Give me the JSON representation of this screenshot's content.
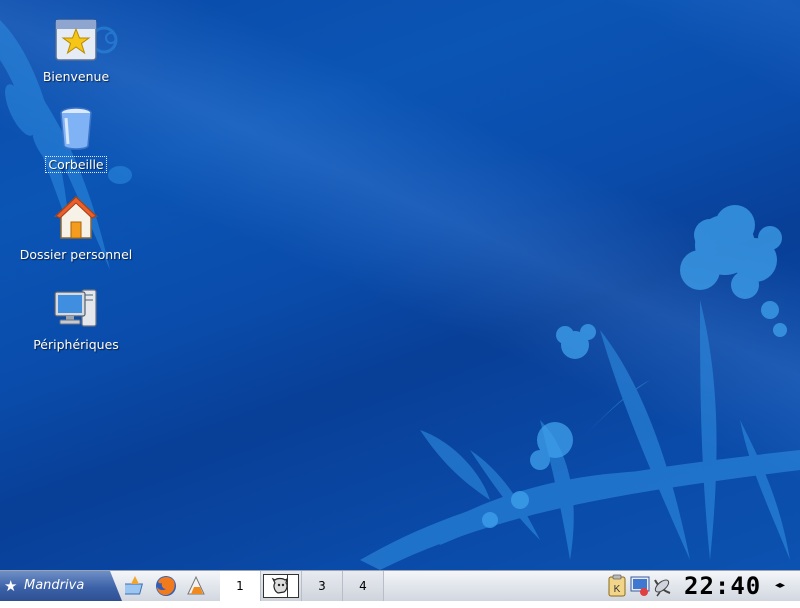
{
  "desktop": {
    "icons": [
      {
        "label": "Bienvenue",
        "icon": "welcome-star-icon"
      },
      {
        "label": "Corbeille",
        "icon": "trash-icon"
      },
      {
        "label": "Dossier personnel",
        "icon": "home-folder-icon"
      },
      {
        "label": "Périphériques",
        "icon": "computer-icon"
      }
    ]
  },
  "taskbar": {
    "start_label": "Mandriva",
    "quick_launch": [
      "desktop-shortcut-icon",
      "firefox-icon",
      "office-icon"
    ],
    "desktops": [
      "1",
      "",
      "3",
      "4"
    ],
    "active_desktop": "1",
    "tray": [
      "klipper-icon",
      "network-monitor-icon",
      "satellite-dish-icon"
    ],
    "clock": "22:40",
    "scroll": "◂▸"
  },
  "colors": {
    "wallpaper": "#0a4aa8",
    "start_button": "#3d62a8",
    "taskbar": "#e2e6ec"
  }
}
